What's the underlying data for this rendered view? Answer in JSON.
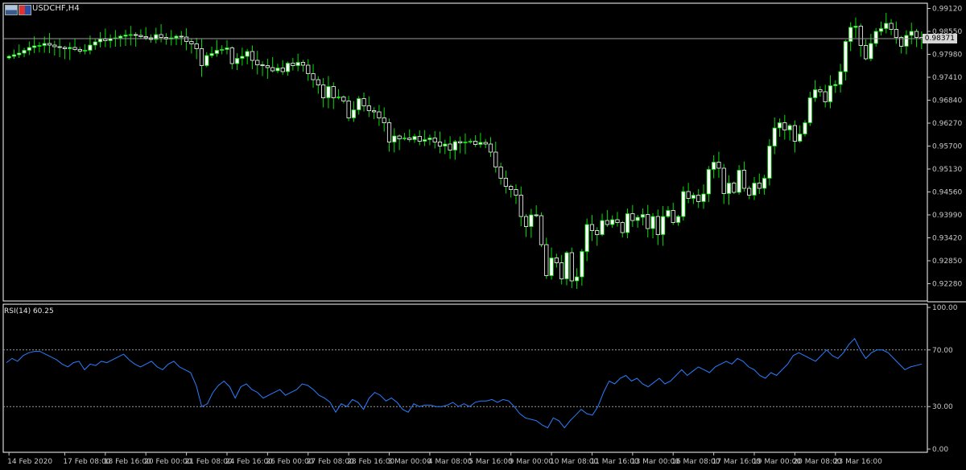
{
  "window": {
    "symbol_title": "USDCHF,H4",
    "icons": [
      "window-icon",
      "flag-icon"
    ]
  },
  "colors": {
    "background": "#000000",
    "bull_candle": "#ffffff",
    "wick": "#00e000",
    "rsi_line": "#2a7fff",
    "grid_dotted": "#9a9a9a",
    "bid_line": "#9a9a9a",
    "text": "#c8c8c8"
  },
  "chart_data": [
    {
      "type": "candlestick",
      "title": "USDCHF,H4",
      "ylim": [
        0.9185,
        0.9925
      ],
      "yticks": [
        "0.99120",
        "0.98550",
        "0.97980",
        "0.97410",
        "0.96840",
        "0.96270",
        "0.95700",
        "0.95130",
        "0.94560",
        "0.93990",
        "0.93420",
        "0.92850",
        "0.92280"
      ],
      "current_price": "0.98371",
      "current_price_value": 0.98371,
      "grid": false,
      "close": [
        0.9793,
        0.9797,
        0.9801,
        0.9808,
        0.9815,
        0.9819,
        0.982,
        0.9825,
        0.9821,
        0.9817,
        0.9815,
        0.9812,
        0.9815,
        0.981,
        0.9806,
        0.9808,
        0.9821,
        0.9829,
        0.9836,
        0.9832,
        0.9837,
        0.9839,
        0.9843,
        0.9846,
        0.9847,
        0.9845,
        0.9842,
        0.9839,
        0.9835,
        0.9847,
        0.984,
        0.9836,
        0.9839,
        0.9843,
        0.9841,
        0.983,
        0.9824,
        0.9812,
        0.977,
        0.9795,
        0.98,
        0.9808,
        0.981,
        0.9814,
        0.9775,
        0.9788,
        0.9793,
        0.9805,
        0.9783,
        0.9772,
        0.977,
        0.9765,
        0.9757,
        0.9764,
        0.9755,
        0.9776,
        0.977,
        0.9778,
        0.9771,
        0.975,
        0.9735,
        0.9722,
        0.969,
        0.9718,
        0.969,
        0.9692,
        0.9682,
        0.964,
        0.966,
        0.9688,
        0.967,
        0.9658,
        0.9655,
        0.964,
        0.9628,
        0.958,
        0.9595,
        0.9588,
        0.959,
        0.9586,
        0.9594,
        0.9582,
        0.9586,
        0.959,
        0.958,
        0.957,
        0.9575,
        0.956,
        0.9581,
        0.9578,
        0.958,
        0.9582,
        0.9574,
        0.9579,
        0.9575,
        0.9555,
        0.9518,
        0.949,
        0.947,
        0.9462,
        0.9448,
        0.9395,
        0.937,
        0.9399,
        0.9397,
        0.9325,
        0.9248,
        0.9292,
        0.928,
        0.924,
        0.9305,
        0.9235,
        0.9245,
        0.9308,
        0.9375,
        0.936,
        0.935,
        0.9385,
        0.9375,
        0.9387,
        0.938,
        0.9355,
        0.9402,
        0.9385,
        0.9393,
        0.94,
        0.9365,
        0.9395,
        0.935,
        0.9395,
        0.941,
        0.938,
        0.9395,
        0.9457,
        0.944,
        0.9448,
        0.9432,
        0.9451,
        0.9512,
        0.953,
        0.9515,
        0.9452,
        0.9478,
        0.9455,
        0.951,
        0.9465,
        0.9448,
        0.9478,
        0.9465,
        0.949,
        0.957,
        0.9615,
        0.9628,
        0.961,
        0.9621,
        0.9582,
        0.96,
        0.9628,
        0.969,
        0.971,
        0.9705,
        0.968,
        0.972,
        0.9723,
        0.9755,
        0.983,
        0.9865,
        0.9868,
        0.982,
        0.9787,
        0.9825,
        0.9855,
        0.9862,
        0.9875,
        0.986,
        0.984,
        0.9818,
        0.9845,
        0.9855,
        0.984,
        0.9837
      ],
      "xticks": [
        {
          "label": "14 Feb 2020",
          "index": 0
        },
        {
          "label": "17 Feb 08:00",
          "index": 11
        },
        {
          "label": "18 Feb 16:00",
          "index": 19
        },
        {
          "label": "20 Feb 00:00",
          "index": 27
        },
        {
          "label": "21 Feb 08:00",
          "index": 35
        },
        {
          "label": "24 Feb 16:00",
          "index": 43
        },
        {
          "label": "26 Feb 00:00",
          "index": 51
        },
        {
          "label": "27 Feb 08:00",
          "index": 59
        },
        {
          "label": "28 Feb 16:00",
          "index": 67
        },
        {
          "label": "3 Mar 00:00",
          "index": 75
        },
        {
          "label": "4 Mar 08:00",
          "index": 83
        },
        {
          "label": "5 Mar 16:00",
          "index": 91
        },
        {
          "label": "9 Mar 00:00",
          "index": 99
        },
        {
          "label": "10 Mar 08:00",
          "index": 107
        },
        {
          "label": "11 Mar 16:00",
          "index": 115
        },
        {
          "label": "13 Mar 00:00",
          "index": 123
        },
        {
          "label": "16 Mar 08:00",
          "index": 131
        },
        {
          "label": "17 Mar 16:00",
          "index": 139
        },
        {
          "label": "19 Mar 00:00",
          "index": 147
        },
        {
          "label": "20 Mar 08:00",
          "index": 155
        },
        {
          "label": "23 Mar 16:00",
          "index": 163
        }
      ]
    },
    {
      "type": "line",
      "title": "RSI(14) 60.25",
      "name": "RSI(14)",
      "current_value": "60.25",
      "ylim": [
        0,
        100
      ],
      "yticks": [
        "100.00",
        "70.00",
        "30.00",
        "0.00"
      ],
      "levels": [
        70,
        30
      ],
      "values": [
        61,
        64,
        62,
        66,
        68,
        69,
        69,
        67,
        65,
        63,
        60,
        58,
        61,
        62,
        56,
        60,
        59,
        62,
        61,
        63,
        65,
        67,
        63,
        60,
        58,
        60,
        62,
        58,
        56,
        60,
        62,
        58,
        56,
        54,
        45,
        30,
        32,
        40,
        45,
        48,
        44,
        36,
        44,
        46,
        42,
        40,
        36,
        38,
        40,
        42,
        38,
        40,
        42,
        46,
        45,
        42,
        38,
        36,
        33,
        26,
        32,
        30,
        35,
        33,
        28,
        36,
        40,
        38,
        34,
        36,
        33,
        28,
        26,
        32,
        30,
        31,
        31,
        30,
        30,
        31,
        33,
        30,
        32,
        30,
        33,
        34,
        34,
        35,
        33,
        35,
        34,
        30,
        25,
        22,
        21,
        20,
        17,
        15,
        22,
        20,
        15,
        20,
        24,
        28,
        25,
        24,
        30,
        40,
        48,
        46,
        50,
        52,
        48,
        50,
        46,
        44,
        47,
        50,
        46,
        48,
        52,
        56,
        52,
        55,
        58,
        56,
        54,
        58,
        60,
        62,
        60,
        64,
        62,
        58,
        56,
        52,
        50,
        54,
        52,
        56,
        60,
        66,
        68,
        66,
        64,
        62,
        66,
        70,
        66,
        64,
        68,
        74,
        78,
        70,
        64,
        68,
        70,
        70,
        68,
        64,
        60,
        56,
        58,
        59,
        60
      ]
    }
  ]
}
